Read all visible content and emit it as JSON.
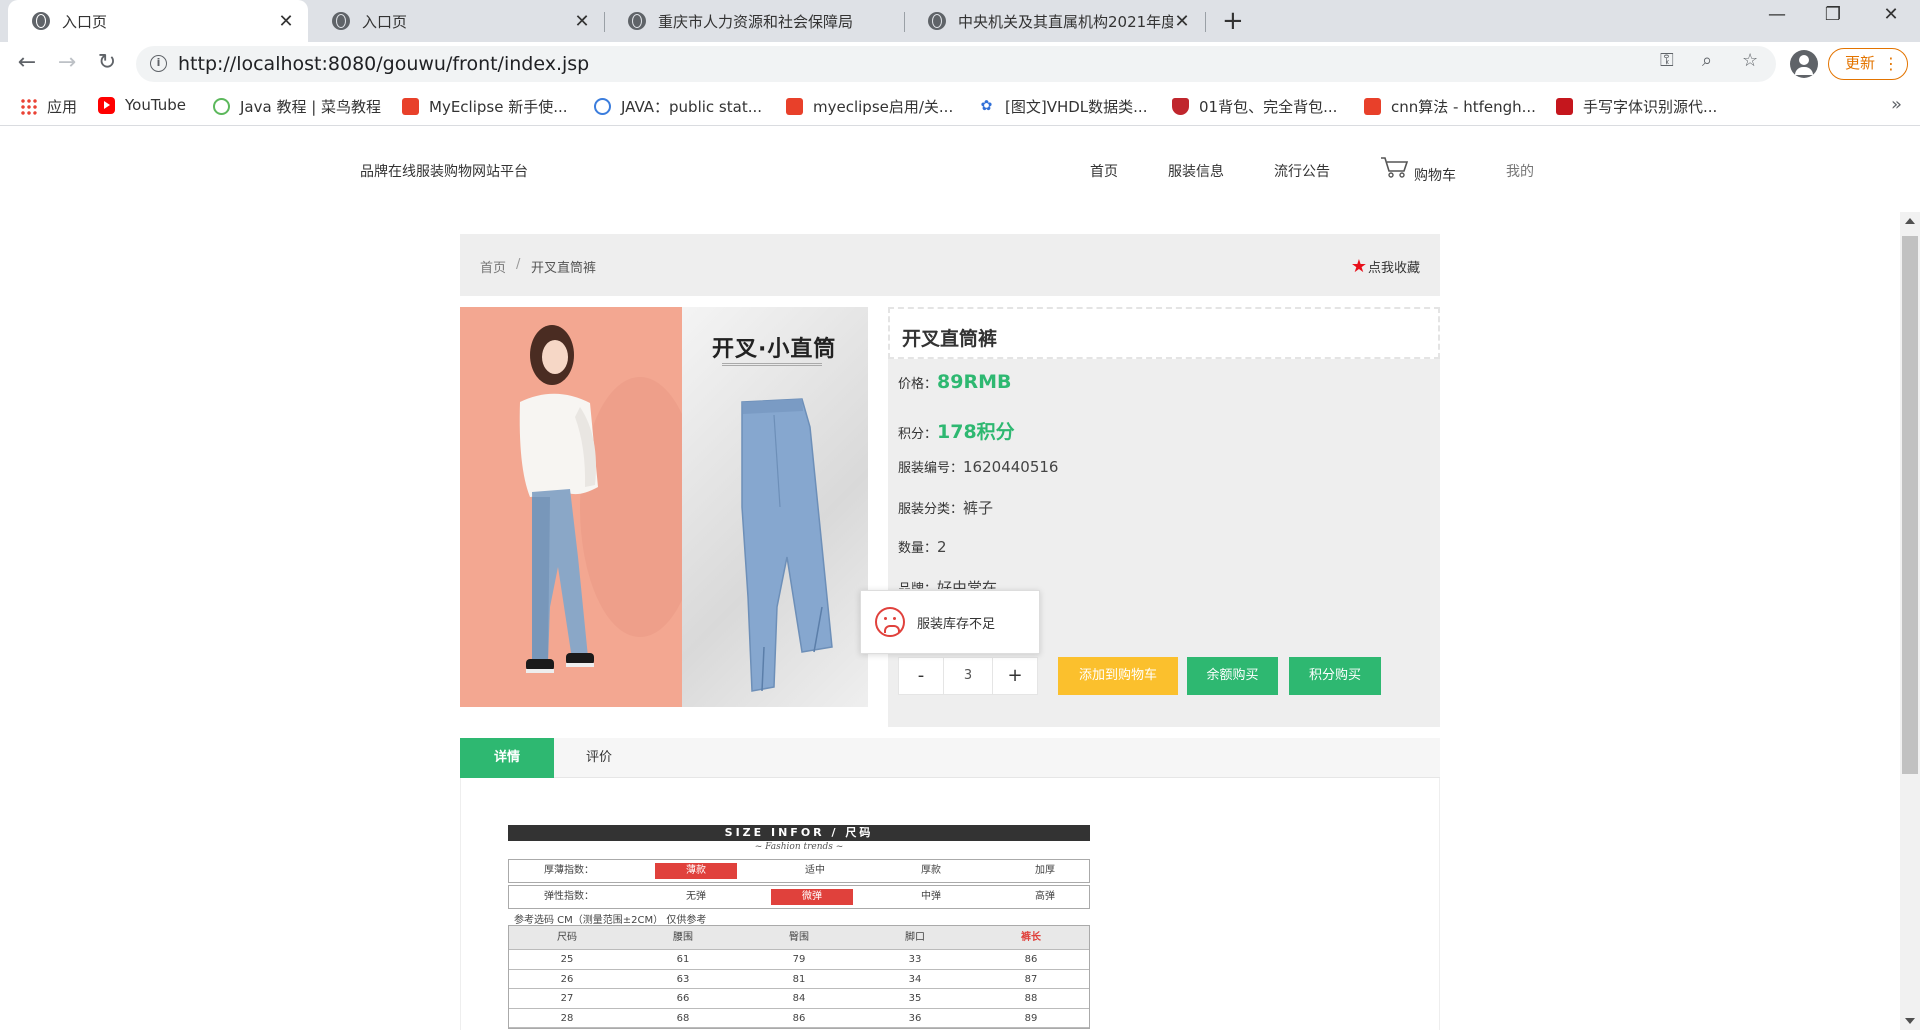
{
  "browser": {
    "tabs": [
      {
        "title": "入口页",
        "active": true
      },
      {
        "title": "入口页",
        "active": false
      },
      {
        "title": "重庆市人力资源和社会保障局",
        "active": false
      },
      {
        "title": "中央机关及其直属机构2021年度",
        "active": false
      }
    ],
    "url": "http://localhost:8080/gouwu/front/index.jsp",
    "update_label": "更新",
    "bookmarks": [
      {
        "label": "应用",
        "icon": "apps-icon"
      },
      {
        "label": "YouTube",
        "icon": "youtube-icon"
      },
      {
        "label": "Java 教程 | 菜鸟教程",
        "icon": "runoob-icon"
      },
      {
        "label": "MyEclipse 新手使...",
        "icon": "csdn-icon"
      },
      {
        "label": "JAVA：public stat...",
        "icon": "blue-circle-icon"
      },
      {
        "label": "myeclipse启用/关...",
        "icon": "csdn-icon"
      },
      {
        "label": "[图文]VHDL数据类...",
        "icon": "baidu-paw-icon"
      },
      {
        "label": "01背包、完全背包...",
        "icon": "shield-icon"
      },
      {
        "label": "cnn算法 - htfengh...",
        "icon": "csdn-icon"
      },
      {
        "label": "手写字体识别源代...",
        "icon": "red-c-icon"
      }
    ]
  },
  "site": {
    "title": "品牌在线服装购物网站平台",
    "nav": {
      "home": "首页",
      "clothing": "服装信息",
      "news": "流行公告",
      "cart": "购物车",
      "mine": "我的"
    }
  },
  "breadcrumb": {
    "home": "首页",
    "separator": "/",
    "current": "开叉直筒裤",
    "favorite": "点我收藏"
  },
  "product": {
    "image_title": "开叉·小直筒",
    "name": "开叉直筒裤",
    "price_label": "价格：",
    "price": "89RMB",
    "points_label": "积分：",
    "points": "178积分",
    "code_label": "服装编号：",
    "code": "1620440516",
    "category_label": "服装分类：",
    "category": "裤子",
    "stock_label": "数量：",
    "stock": "2",
    "brand_label": "品牌：",
    "brand": "好由常在",
    "quantity": "3",
    "minus": "-",
    "plus": "+",
    "add_to_cart": "添加到购物车",
    "buy_balance": "余额购买",
    "buy_points": "积分购买"
  },
  "toast": {
    "message": "服装库存不足"
  },
  "product_tabs": {
    "details": "详情",
    "reviews": "评价"
  },
  "size_chart": {
    "header": "SIZE INFOR / 尺码",
    "subheader": "~ Fashion trends ~",
    "thickness_label": "厚薄指数：",
    "thickness_options": [
      "薄款",
      "适中",
      "厚款",
      "加厚"
    ],
    "thickness_selected": 0,
    "elastic_label": "弹性指数：",
    "elastic_options": [
      "无弹",
      "微弹",
      "中弹",
      "高弹"
    ],
    "elastic_selected": 1,
    "note": "参考选码 CM（测量范围±2CM） 仅供参考",
    "columns": [
      "尺码",
      "腰围",
      "臀围",
      "脚口",
      "裤长"
    ],
    "rows": [
      [
        "25",
        "61",
        "79",
        "33",
        "86"
      ],
      [
        "26",
        "63",
        "81",
        "34",
        "87"
      ],
      [
        "27",
        "66",
        "84",
        "35",
        "88"
      ],
      [
        "28",
        "68",
        "86",
        "36",
        "89"
      ]
    ]
  }
}
